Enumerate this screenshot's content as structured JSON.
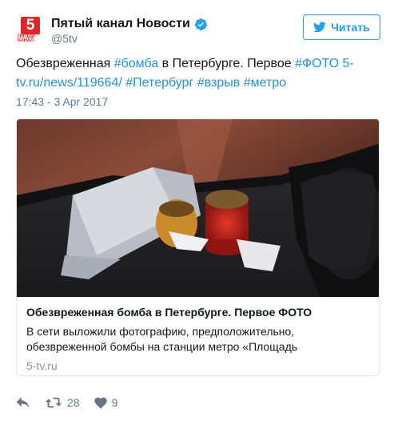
{
  "account": {
    "display_name": "Пятый канал Новости",
    "handle": "@5tv",
    "avatar": {
      "digit": "5",
      "brand_text": "ПЯТЫЙ КАНАЛ",
      "brand_color": "#e32526",
      "icon": "channel-logo"
    },
    "verified_icon": "verified-badge-icon"
  },
  "follow_button": {
    "label": "Читать",
    "icon": "twitter-bird-icon",
    "color": "#1da1f2"
  },
  "tweet": {
    "segments": [
      {
        "text": "Обезвреженная ",
        "link": false
      },
      {
        "text": "#бомба",
        "link": true
      },
      {
        "text": " в Петербурге. Первое ",
        "link": false
      },
      {
        "text": "#ФОТО",
        "link": true
      },
      {
        "text": " ",
        "link": false
      },
      {
        "text": "5-tv.ru/news/119664/",
        "link": true
      },
      {
        "text": " ",
        "link": false
      },
      {
        "text": "#Петербург",
        "link": true
      },
      {
        "text": " ",
        "link": false
      },
      {
        "text": "#взрыв",
        "link": true
      },
      {
        "text": " ",
        "link": false
      },
      {
        "text": "#метро",
        "link": true
      }
    ],
    "timestamp": "17:43 - 3 Apr 2017",
    "link_color": "#1b95e0"
  },
  "card": {
    "title": "Обезвреженная бомба в Петербурге. Первое ФОТО",
    "description": "В сети выложили фотографию, предположительно, обезвреженной бомбы на станции метро «Площадь",
    "domain": "5-tv.ru"
  },
  "actions": {
    "reply": {
      "icon": "reply-icon"
    },
    "retweet": {
      "icon": "retweet-icon",
      "count": "28"
    },
    "like": {
      "icon": "heart-icon",
      "count": "9"
    }
  }
}
